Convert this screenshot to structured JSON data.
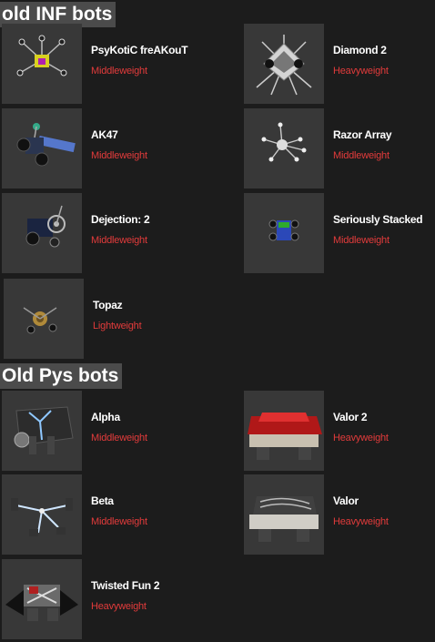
{
  "sections": [
    {
      "title": "old INF bots",
      "bots": [
        {
          "name": "PsyKotiC freAKouT",
          "class": "Middleweight",
          "icon": "robot-thumbnail"
        },
        {
          "name": "Diamond 2",
          "class": "Heavyweight",
          "icon": "robot-thumbnail"
        },
        {
          "name": "AK47",
          "class": "Middleweight",
          "icon": "robot-thumbnail"
        },
        {
          "name": "Razor Array",
          "class": "Middleweight",
          "icon": "robot-thumbnail"
        },
        {
          "name": "Dejection: 2",
          "class": "Middleweight",
          "icon": "robot-thumbnail"
        },
        {
          "name": "Seriously Stacked",
          "class": "Middleweight",
          "icon": "robot-thumbnail"
        },
        {
          "name": "Topaz",
          "class": "Lightweight",
          "icon": "robot-thumbnail"
        }
      ]
    },
    {
      "title": "Old Pys bots",
      "bots": [
        {
          "name": "Alpha",
          "class": "Middleweight",
          "icon": "robot-thumbnail"
        },
        {
          "name": "Valor 2",
          "class": "Heavyweight",
          "icon": "robot-thumbnail"
        },
        {
          "name": "Beta",
          "class": "Middleweight",
          "icon": "robot-thumbnail"
        },
        {
          "name": "Valor",
          "class": "Heavyweight",
          "icon": "robot-thumbnail"
        },
        {
          "name": "Twisted Fun 2",
          "class": "Heavyweight",
          "icon": "robot-thumbnail"
        }
      ]
    }
  ],
  "colors": {
    "background": "#1c1c1c",
    "header_bg": "#4b4b4b",
    "thumb_bg": "#383838",
    "name": "#ffffff",
    "weight_class": "#e23b3b"
  }
}
